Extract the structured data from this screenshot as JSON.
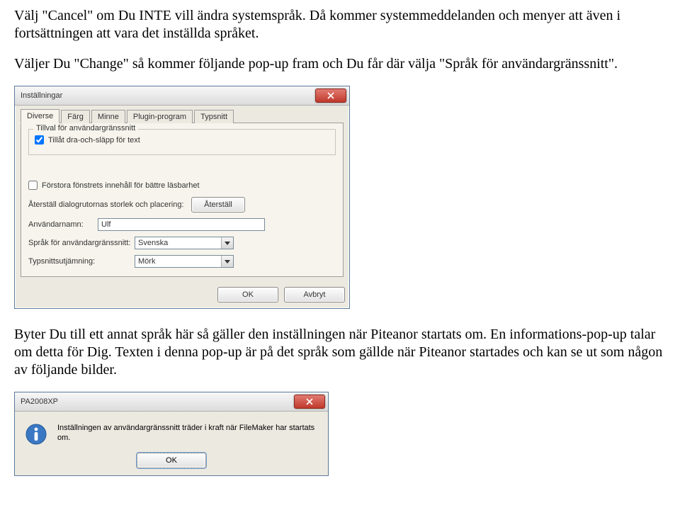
{
  "paragraphs": {
    "p1": "Välj \"Cancel\" om Du INTE vill ändra systemspråk. Då kommer systemmeddelanden och menyer att även i fortsättningen att vara det inställda språket.",
    "p2": "Väljer Du \"Change\" så kommer följande pop-up fram och Du får där välja \"Språk för användargränssnitt\".",
    "p3": "Byter Du till ett annat språk här så gäller den inställningen när Piteanor startats om. En informations-pop-up talar om detta för Dig. Texten i denna pop-up är på det språk som gällde när Piteanor startades och kan se ut som någon av följande bilder."
  },
  "settings_dialog": {
    "title": "Inställningar",
    "tabs": [
      "Diverse",
      "Färg",
      "Minne",
      "Plugin-program",
      "Typsnitt"
    ],
    "group_title": "Tillval för användargränssnitt",
    "checkbox_drag": "Tillåt dra-och-släpp för text",
    "checkbox_enlarge": "Förstora fönstrets innehåll för bättre läsbarhet",
    "row_reset_label": "Återställ dialogrutornas storlek och placering:",
    "reset_btn": "Återställ",
    "row_user_label": "Användarnamn:",
    "user_value": "Ulf",
    "row_lang_label": "Språk för användargränssnitt:",
    "lang_value": "Svenska",
    "row_font_label": "Typsnittsutjämning:",
    "font_value": "Mörk",
    "ok": "OK",
    "cancel": "Avbryt"
  },
  "info_dialog": {
    "title": "PA2008XP",
    "text": "Inställningen av användargränssnitt träder i kraft när FileMaker har startats om.",
    "ok": "OK"
  }
}
